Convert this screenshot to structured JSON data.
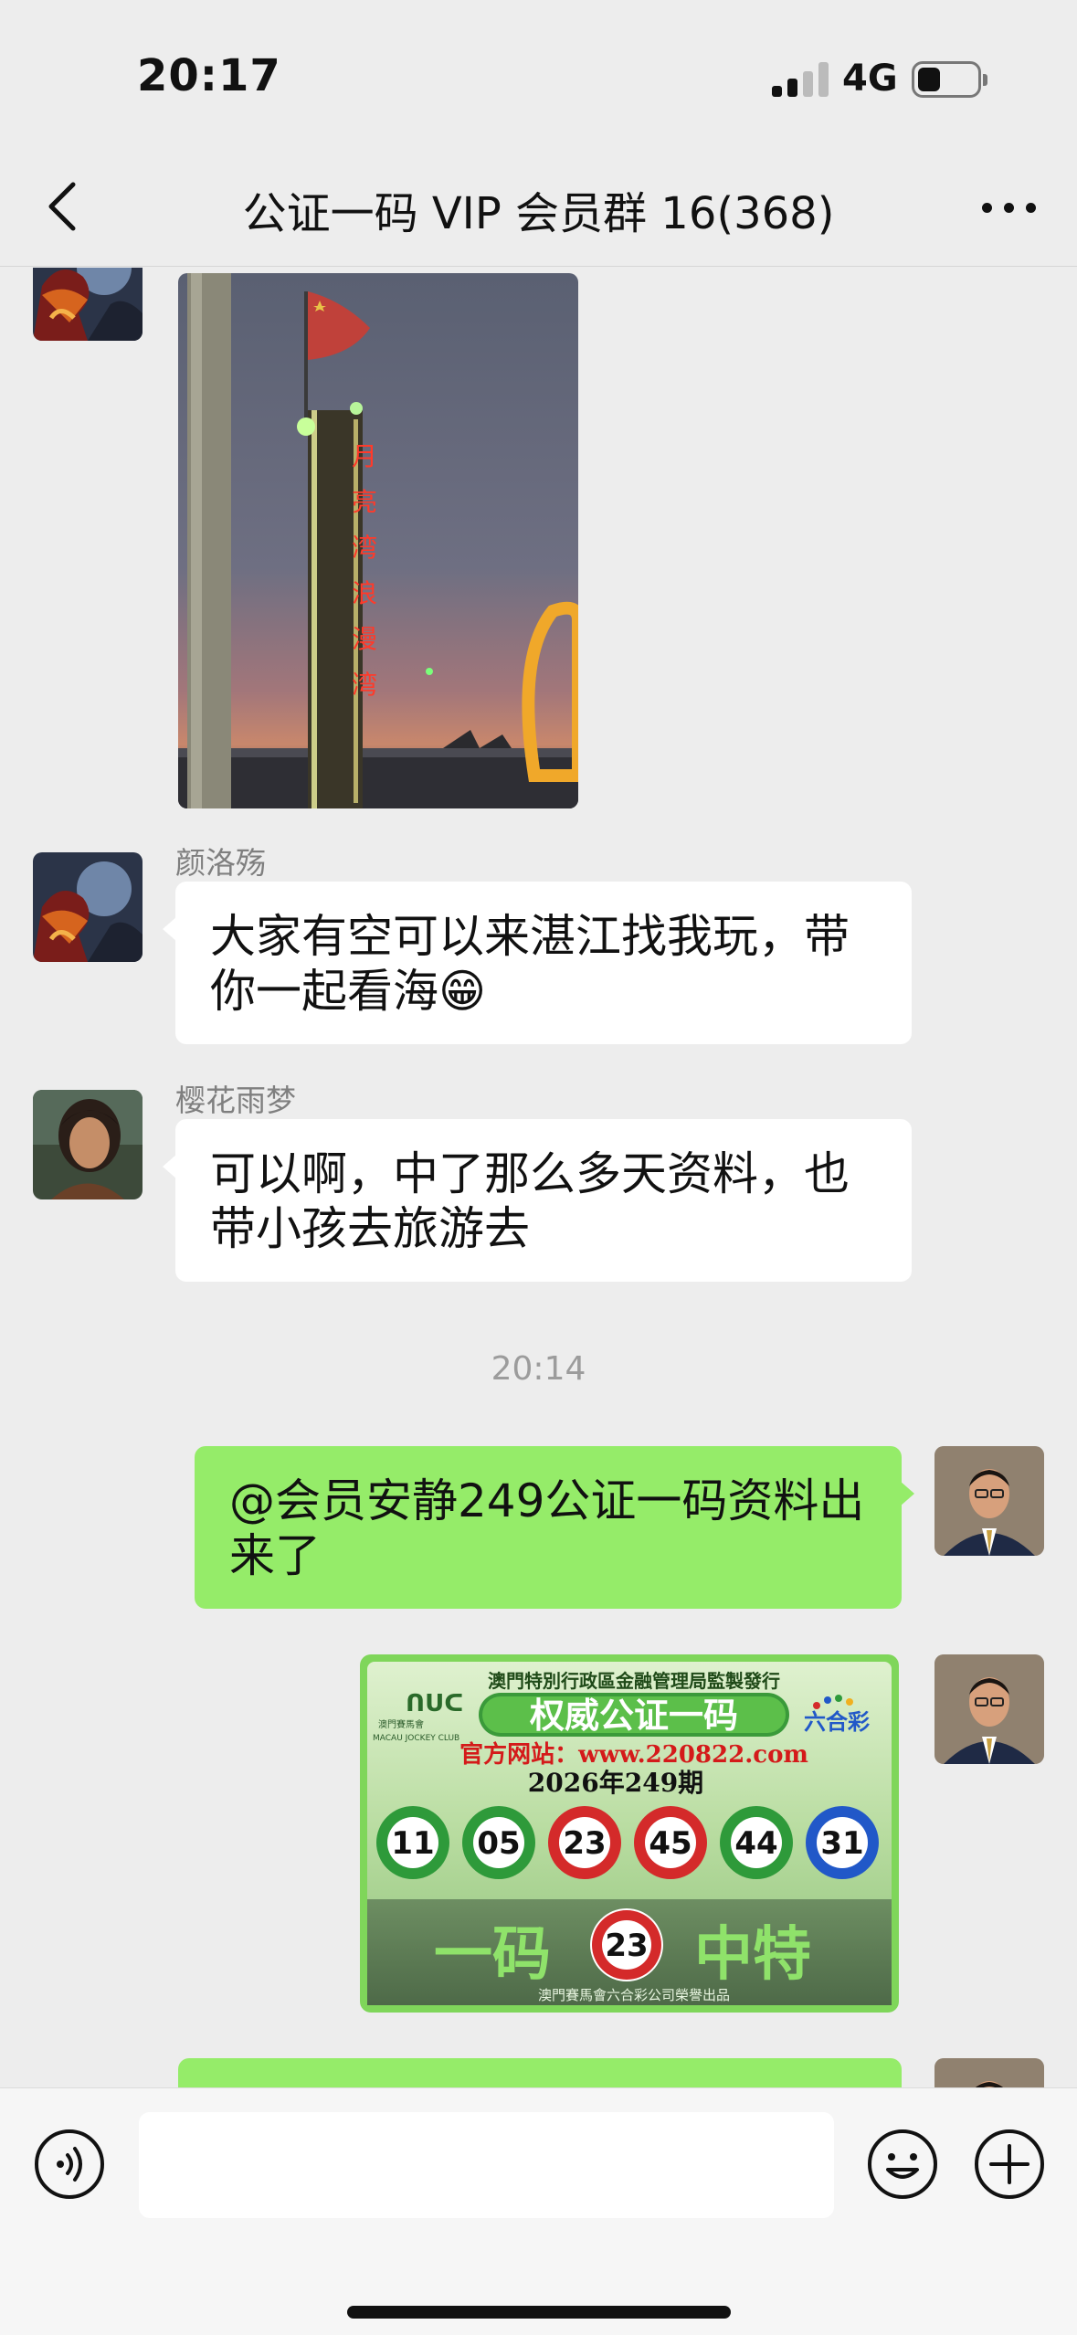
{
  "status_bar": {
    "time": "20:17",
    "network": "4G",
    "signal_bars_active": 2,
    "signal_bars_total": 4,
    "battery_level": 0.3
  },
  "nav": {
    "title": "公证一码 VIP 会员群 16(368)",
    "back_icon": "chevron-left-icon",
    "more_icon": "more-dots-icon"
  },
  "messages": [
    {
      "type": "image",
      "side": "left",
      "avatar": "dragon-warrior-avatar",
      "image_desc": "seaside-sunset-photo"
    },
    {
      "type": "text",
      "side": "left",
      "sender": "颜洛殇",
      "avatar": "dragon-warrior-avatar",
      "text": "大家有空可以来湛江找我玩，带你一起看海😁"
    },
    {
      "type": "text",
      "side": "left",
      "sender": "樱花雨梦",
      "avatar": "girl-portrait-avatar",
      "text": "可以啊，中了那么多天资料，也带小孩去旅游去"
    },
    {
      "type": "timestamp",
      "text": "20:14"
    },
    {
      "type": "text",
      "side": "right",
      "avatar": "man-in-suit-avatar",
      "text": "@会员安静249公证一码资料出来了"
    },
    {
      "type": "image",
      "side": "right",
      "avatar": "man-in-suit-avatar",
      "promo": {
        "top_line": "澳門特別行政區金融管理局監製發行",
        "left_logo_line1": "澳門賽馬會",
        "left_logo_line2": "MACAU JOCKEY CLUB",
        "right_logo": "六合彩",
        "headline": "权威公证一码",
        "website": "官方网站：www.220822.com",
        "issue": "2026年249期",
        "balls": [
          {
            "number": "11",
            "color": "#2e9a3a"
          },
          {
            "number": "05",
            "color": "#2e9a3a"
          },
          {
            "number": "23",
            "color": "#d42a2a"
          },
          {
            "number": "45",
            "color": "#d42a2a"
          },
          {
            "number": "44",
            "color": "#2e9a3a"
          },
          {
            "number": "31",
            "color": "#2158c8"
          }
        ],
        "special_left": "一码",
        "special_number": "23",
        "special_right": "中特",
        "footer": "澳門賽馬會六合彩公司榮譽出品"
      }
    },
    {
      "type": "text",
      "side": "right",
      "avatar": "man-in-suit-avatar",
      "text": ""
    }
  ],
  "input_bar": {
    "voice_icon": "voice-icon",
    "emoji_icon": "emoji-icon",
    "plus_icon": "plus-icon",
    "input_value": ""
  },
  "colors": {
    "background": "#ededed",
    "my_bubble": "#95ec69",
    "other_bubble": "#ffffff",
    "name_gray": "#7f7f7f"
  }
}
